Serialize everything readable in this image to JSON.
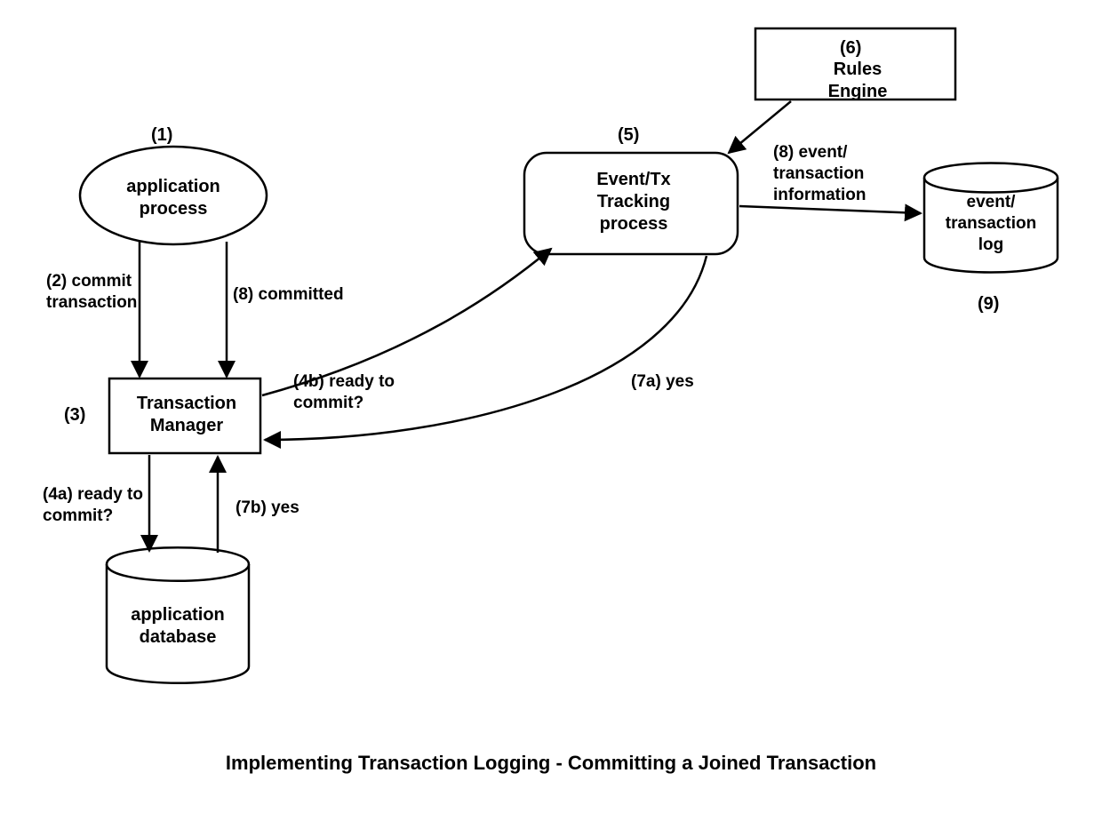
{
  "title": "Implementing Transaction Logging - Committing a Joined Transaction",
  "nodes": {
    "app_process": {
      "num": "(1)",
      "text": "application\nprocess"
    },
    "tx_manager": {
      "num": "(3)",
      "text": "Transaction\nManager"
    },
    "app_db": {
      "text": "application\ndatabase"
    },
    "event_tx": {
      "num": "(5)",
      "text": "Event/Tx\nTracking\nprocess"
    },
    "rules": {
      "num": "(6)",
      "text": "Rules\nEngine"
    },
    "event_log": {
      "num": "(9)",
      "text": "event/\ntransaction\nlog"
    }
  },
  "edges": {
    "e2": "(2) commit\ntransaction",
    "e8a": "(8) committed",
    "e4a": "(4a) ready to\ncommit?",
    "e7b": "(7b) yes",
    "e4b": "(4b) ready to\ncommit?",
    "e7a": "(7a) yes",
    "e8b": "(8) event/\ntransaction\ninformation"
  }
}
